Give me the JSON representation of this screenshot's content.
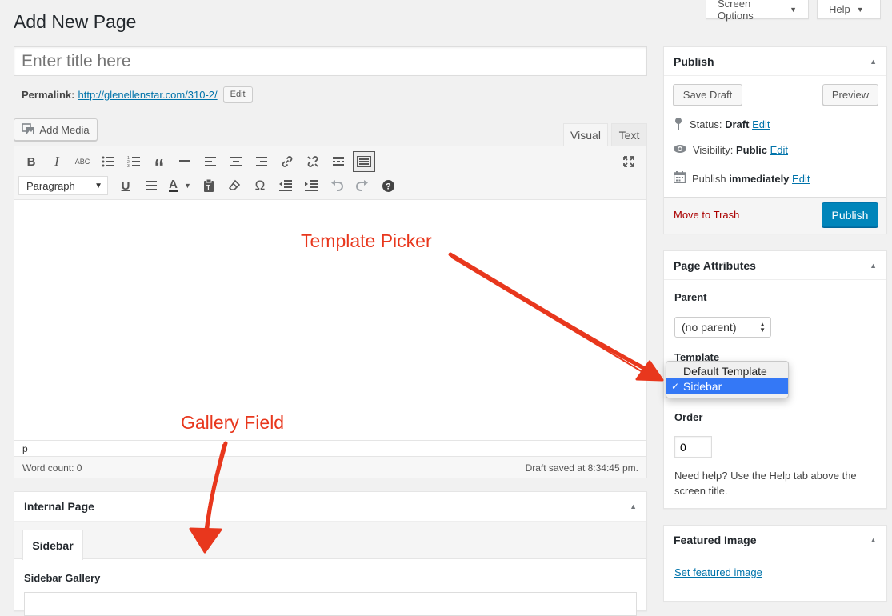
{
  "header": {
    "title": "Add New Page",
    "screen_options": "Screen Options",
    "help": "Help"
  },
  "editor": {
    "title_placeholder": "Enter title here",
    "permalink_label": "Permalink:",
    "permalink_url": "http://glenellenstar.com/310-2/",
    "permalink_edit": "Edit",
    "add_media": "Add Media",
    "tabs": [
      "Visual",
      "Text"
    ],
    "format_select": "Paragraph",
    "path": "p",
    "word_count": "Word count: 0",
    "draft_saved": "Draft saved at 8:34:45 pm."
  },
  "publish": {
    "heading": "Publish",
    "save_draft": "Save Draft",
    "preview": "Preview",
    "status_label": "Status:",
    "status_value": "Draft",
    "visibility_label": "Visibility:",
    "visibility_value": "Public",
    "publish_label": "Publish",
    "publish_value": "immediately",
    "edit": "Edit",
    "move_to_trash": "Move to Trash",
    "publish_button": "Publish"
  },
  "page_attributes": {
    "heading": "Page Attributes",
    "parent_label": "Parent",
    "parent_value": "(no parent)",
    "template_label": "Template",
    "template_options": [
      "Default Template",
      "Sidebar"
    ],
    "template_selected": "Sidebar",
    "order_label": "Order",
    "order_value": "0",
    "help_text": "Need help? Use the Help tab above the screen title."
  },
  "featured_image": {
    "heading": "Featured Image",
    "link": "Set featured image"
  },
  "internal_page": {
    "heading": "Internal Page",
    "tab": "Sidebar",
    "field_label": "Sidebar Gallery"
  },
  "annotations": {
    "template_picker": "Template Picker",
    "gallery_field": "Gallery Field"
  },
  "colors": {
    "accent": "#0073aa",
    "primary_button": "#0085ba",
    "annotation": "#e8371d",
    "trash": "#a00"
  }
}
